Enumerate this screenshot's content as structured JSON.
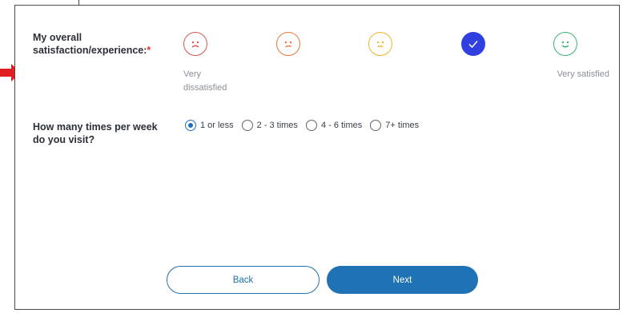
{
  "survey": {
    "satisfaction": {
      "label": "My overall satisfaction/experience:",
      "required_mark": "*",
      "options": [
        {
          "icon": "very-dissatisfied-face-icon",
          "color": "#d9534f",
          "selected": false
        },
        {
          "icon": "dissatisfied-face-icon",
          "color": "#e8763a",
          "selected": false
        },
        {
          "icon": "neutral-face-icon",
          "color": "#f0b429",
          "selected": false
        },
        {
          "icon": "checkmark-icon",
          "color": "#2f3fe0",
          "selected": true
        },
        {
          "icon": "very-satisfied-face-icon",
          "color": "#3bb273",
          "selected": false
        }
      ],
      "low_label": "Very dissatisfied",
      "high_label": "Very satisfied"
    },
    "visits": {
      "label": "How many times per week do you visit?",
      "options": [
        {
          "label": "1 or less",
          "selected": true
        },
        {
          "label": "2 - 3 times",
          "selected": false
        },
        {
          "label": "4 - 6 times",
          "selected": false
        },
        {
          "label": "7+ times",
          "selected": false
        }
      ]
    }
  },
  "buttons": {
    "back": "Back",
    "next": "Next"
  },
  "colors": {
    "accent": "#1f72b4",
    "required": "#e03131",
    "annotation_arrow": "#e02020"
  }
}
